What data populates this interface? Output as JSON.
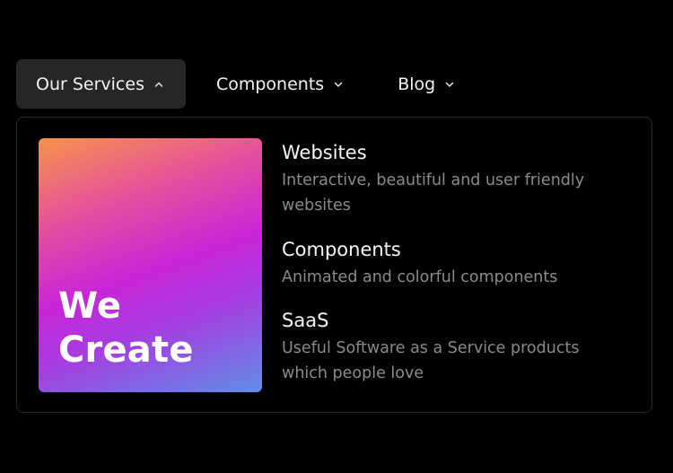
{
  "nav": {
    "items": [
      {
        "label": "Our Services",
        "state": "open"
      },
      {
        "label": "Components",
        "state": "closed"
      },
      {
        "label": "Blog",
        "state": "closed"
      }
    ]
  },
  "dropdown": {
    "promo": {
      "line1": "We",
      "line2": "Create"
    },
    "links": [
      {
        "title": "Websites",
        "description": "Interactive, beautiful and user friendly websites"
      },
      {
        "title": "Components",
        "description": "Animated and colorful components"
      },
      {
        "title": "SaaS",
        "description": "Useful Software as a Service products which people love"
      }
    ]
  },
  "colors": {
    "background": "#000000",
    "active_tab": "#262626",
    "border": "#2a2a2a",
    "muted_text": "#8a8a8a",
    "gradient_start": "#f7934a",
    "gradient_mid": "#c825d8",
    "gradient_end": "#5f8ee8"
  },
  "icons": {
    "open": "chevron-up-icon",
    "closed": "chevron-down-icon"
  }
}
